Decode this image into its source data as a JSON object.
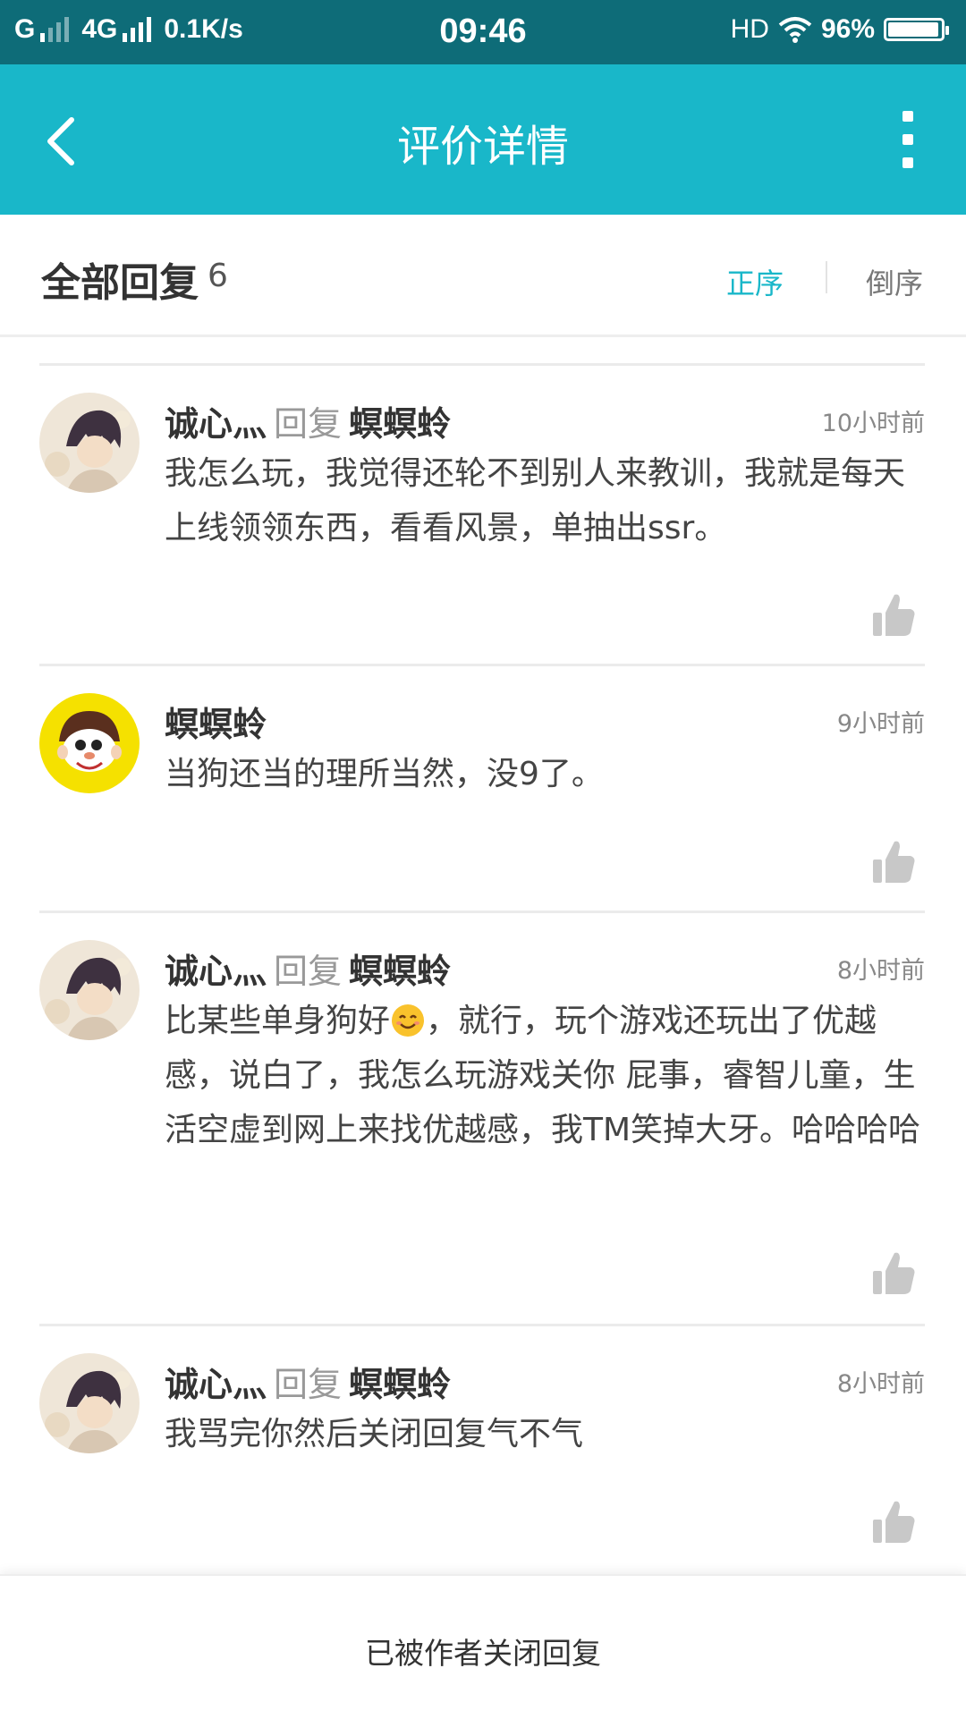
{
  "status_bar": {
    "network_left": "G",
    "network_4g": "4G",
    "speed": "0.1K/s",
    "time": "09:46",
    "hd": "HD",
    "battery": "96%",
    "battery_level": 0.96
  },
  "titlebar": {
    "title": "评价详情",
    "back_icon": "chevron-left-icon",
    "more_icon": "more-vertical-icon"
  },
  "header": {
    "title": "全部回复",
    "count": "6",
    "sort_asc": "正序",
    "sort_desc": "倒序",
    "accent_color": "#19b7c9"
  },
  "comments": [
    {
      "author": "诚心灬",
      "reply_word": "回复",
      "target": "螟螟蛉",
      "time": "10小时前",
      "text": "我怎么玩，我觉得还轮不到别人来教训，我就是每天上线领领东西，看看风景，单抽出ssr。"
    },
    {
      "author": "螟螟蛉",
      "time": "9小时前",
      "text": "当狗还当的理所当然，没9了。"
    },
    {
      "author": "诚心灬",
      "reply_word": "回复",
      "target": "螟螟蛉",
      "time": "8小时前",
      "text_before_emoji": "比某些单身狗好",
      "text_after_emoji": "，就行，玩个游戏还玩出了优越感，说白了，我怎么玩游戏关你 屁事，睿智儿童，生活空虚到网上来找优越感，我TM笑掉大牙。哈哈哈哈"
    },
    {
      "author": "诚心灬",
      "reply_word": "回复",
      "target": "螟螟蛉",
      "time": "8小时前",
      "text": "我骂完你然后关闭回复气不气"
    }
  ],
  "footer": {
    "text": "已被作者关闭回复"
  }
}
